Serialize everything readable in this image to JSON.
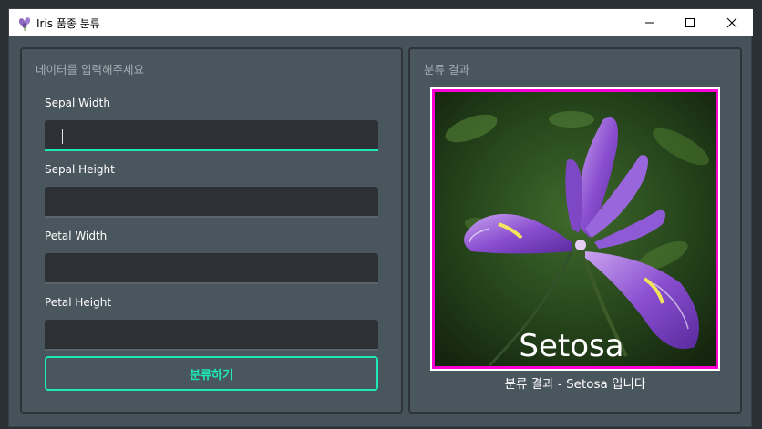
{
  "window": {
    "title": "Iris 품종 분류",
    "app_icon": "iris-flower-icon"
  },
  "left_panel": {
    "title": "데이터를 입력해주세요",
    "fields": [
      {
        "label": "Sepal Width",
        "value": ""
      },
      {
        "label": "Sepal Height",
        "value": ""
      },
      {
        "label": "Petal Width",
        "value": ""
      },
      {
        "label": "Petal Height",
        "value": ""
      }
    ],
    "classify_button": "분류하기"
  },
  "right_panel": {
    "title": "분류 결과",
    "image_caption": "Setosa",
    "result_text": "분류 결과 - Setosa 입니다"
  },
  "colors": {
    "accent": "#1de9b6",
    "image_border": "#ff00d4",
    "panel_bg": "#4a565e"
  }
}
